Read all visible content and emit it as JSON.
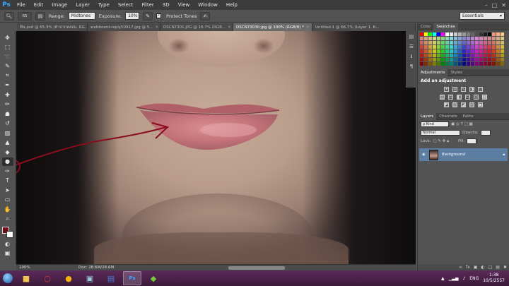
{
  "app": {
    "logo": "Ps"
  },
  "menu": [
    "File",
    "Edit",
    "Image",
    "Layer",
    "Type",
    "Select",
    "Filter",
    "3D",
    "View",
    "Window",
    "Help"
  ],
  "window_controls": [
    "–",
    "□",
    "✕"
  ],
  "options": {
    "brush_size": "65",
    "range_label": "Range:",
    "range_value": "Midtones",
    "exposure_label": "Exposure:",
    "exposure_value": "10%",
    "protect_tones_label": "Protect Tones",
    "workspace": "Essentials"
  },
  "tabs": [
    {
      "label": "ฟิน.psd @ 65.3% (ทำปากหลอน, RG...",
      "active": false
    },
    {
      "label": "webboard-reply50917.jpg @ 5...",
      "active": false
    },
    {
      "label": "DSCN7301.JPG @ 16.7% (RGB...",
      "active": false
    },
    {
      "label": "DSCN73030.jpg @ 100% (RGB/8) *",
      "active": true
    },
    {
      "label": "Untitled-1 @ 66.7% (Layer 1, R...",
      "active": false
    }
  ],
  "status": {
    "zoom": "100%",
    "doc": "Doc: 28.6M/28.6M"
  },
  "panels": {
    "color_tab": "Color",
    "swatches_tab": "Swatches",
    "adjustments_tab": "Adjustments",
    "styles_tab": "Styles",
    "add_adjustment": "Add an adjustment",
    "layers_tab": "Layers",
    "channels_tab": "Channels",
    "paths_tab": "Paths",
    "kind_label": "ρ Kind",
    "blend_mode": "Normal",
    "opacity_label": "Opacity:",
    "lock_label": "Lock:",
    "fill_label": "Fill:",
    "layer_name": "Background"
  },
  "taskbar": {
    "apps": [
      "folder",
      "opera",
      "chrome",
      "explorer",
      "word",
      "photoshop",
      "bluestacks"
    ],
    "lang": "ENG",
    "time": "1:38",
    "date": "10/5/2557"
  },
  "colors": {
    "foreground": "#6d0a14",
    "background": "#ffffff",
    "arrow": "#8a0c1c"
  }
}
